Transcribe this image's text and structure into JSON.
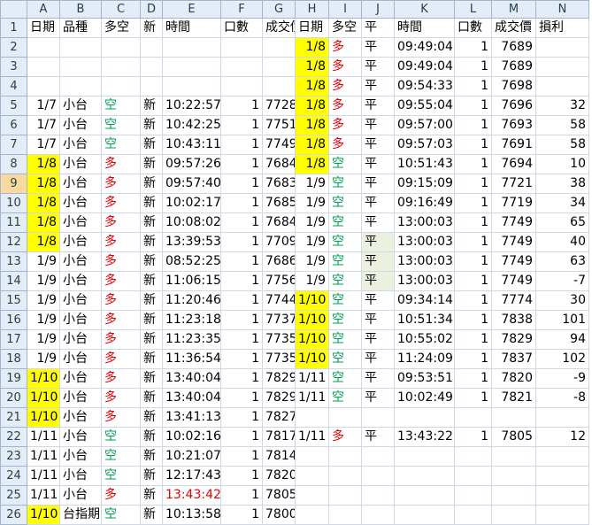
{
  "columns": [
    "A",
    "B",
    "C",
    "D",
    "E",
    "F",
    "G",
    "H",
    "I",
    "J",
    "K",
    "L",
    "M",
    "N"
  ],
  "selected_row": "9",
  "rows": [
    {
      "n": "1",
      "c": [
        "日期",
        "品種",
        "多空",
        "新",
        "時間",
        "口數",
        "成交價",
        "日期",
        "多空",
        "平",
        "時間",
        "口數",
        "成交價",
        "損利"
      ]
    },
    {
      "n": "2",
      "c": [
        "",
        "",
        "",
        "",
        "",
        "",
        "",
        "1/8",
        "多",
        "平",
        "09:49:04",
        "1",
        "7689",
        ""
      ]
    },
    {
      "n": "3",
      "c": [
        "",
        "",
        "",
        "",
        "",
        "",
        "",
        "1/8",
        "多",
        "平",
        "09:49:04",
        "1",
        "7689",
        ""
      ]
    },
    {
      "n": "4",
      "c": [
        "",
        "",
        "",
        "",
        "",
        "",
        "",
        "1/8",
        "多",
        "平",
        "09:54:33",
        "1",
        "7698",
        ""
      ]
    },
    {
      "n": "5",
      "c": [
        "1/7",
        "小台",
        "空",
        "新",
        "10:22:57",
        "1",
        "7728",
        "1/8",
        "多",
        "平",
        "09:55:04",
        "1",
        "7696",
        "32"
      ]
    },
    {
      "n": "6",
      "c": [
        "1/7",
        "小台",
        "空",
        "新",
        "10:42:25",
        "1",
        "7751",
        "1/8",
        "多",
        "平",
        "09:57:00",
        "1",
        "7693",
        "58"
      ]
    },
    {
      "n": "7",
      "c": [
        "1/7",
        "小台",
        "空",
        "新",
        "10:43:11",
        "1",
        "7749",
        "1/8",
        "多",
        "平",
        "09:57:03",
        "1",
        "7691",
        "58"
      ]
    },
    {
      "n": "8",
      "c": [
        "1/8",
        "小台",
        "多",
        "新",
        "09:57:26",
        "1",
        "7684",
        "1/8",
        "空",
        "平",
        "10:51:43",
        "1",
        "7694",
        "10"
      ]
    },
    {
      "n": "9",
      "c": [
        "1/8",
        "小台",
        "多",
        "新",
        "09:57:40",
        "1",
        "7683",
        "1/9",
        "空",
        "平",
        "09:15:09",
        "1",
        "7721",
        "38"
      ]
    },
    {
      "n": "10",
      "c": [
        "1/8",
        "小台",
        "多",
        "新",
        "10:02:17",
        "1",
        "7685",
        "1/9",
        "空",
        "平",
        "09:16:49",
        "1",
        "7719",
        "34"
      ]
    },
    {
      "n": "11",
      "c": [
        "1/8",
        "小台",
        "多",
        "新",
        "10:08:02",
        "1",
        "7684",
        "1/9",
        "空",
        "平",
        "13:00:03",
        "1",
        "7749",
        "65"
      ]
    },
    {
      "n": "12",
      "c": [
        "1/8",
        "小台",
        "多",
        "新",
        "13:39:53",
        "1",
        "7709",
        "1/9",
        "空",
        "平",
        "13:00:03",
        "1",
        "7749",
        "40"
      ]
    },
    {
      "n": "13",
      "c": [
        "1/9",
        "小台",
        "多",
        "新",
        "08:52:25",
        "1",
        "7686",
        "1/9",
        "空",
        "平",
        "13:00:03",
        "1",
        "7749",
        "63"
      ]
    },
    {
      "n": "14",
      "c": [
        "1/9",
        "小台",
        "多",
        "新",
        "11:06:15",
        "1",
        "7756",
        "1/9",
        "空",
        "平",
        "13:00:03",
        "1",
        "7749",
        "-7"
      ]
    },
    {
      "n": "15",
      "c": [
        "1/9",
        "小台",
        "多",
        "新",
        "11:20:46",
        "1",
        "7744",
        "1/10",
        "空",
        "平",
        "09:34:14",
        "1",
        "7774",
        "30"
      ]
    },
    {
      "n": "16",
      "c": [
        "1/9",
        "小台",
        "多",
        "新",
        "11:23:18",
        "1",
        "7737",
        "1/10",
        "空",
        "平",
        "10:51:34",
        "1",
        "7838",
        "101"
      ]
    },
    {
      "n": "17",
      "c": [
        "1/9",
        "小台",
        "多",
        "新",
        "11:23:35",
        "1",
        "7735",
        "1/10",
        "空",
        "平",
        "10:55:02",
        "1",
        "7829",
        "94"
      ]
    },
    {
      "n": "18",
      "c": [
        "1/9",
        "小台",
        "多",
        "新",
        "11:36:54",
        "1",
        "7735",
        "1/10",
        "空",
        "平",
        "11:24:09",
        "1",
        "7837",
        "102"
      ]
    },
    {
      "n": "19",
      "c": [
        "1/10",
        "小台",
        "多",
        "新",
        "13:40:04",
        "1",
        "7829",
        "1/11",
        "空",
        "平",
        "09:53:51",
        "1",
        "7820",
        "-9"
      ]
    },
    {
      "n": "20",
      "c": [
        "1/10",
        "小台",
        "多",
        "新",
        "13:40:04",
        "1",
        "7829",
        "1/11",
        "空",
        "平",
        "10:02:49",
        "1",
        "7821",
        "-8"
      ]
    },
    {
      "n": "21",
      "c": [
        "1/10",
        "小台",
        "多",
        "新",
        "13:41:13",
        "1",
        "7827",
        "",
        "",
        "",
        "",
        "",
        "",
        ""
      ]
    },
    {
      "n": "22",
      "c": [
        "1/11",
        "小台",
        "空",
        "新",
        "10:02:16",
        "1",
        "7817",
        "1/11",
        "多",
        "平",
        "13:43:22",
        "1",
        "7805",
        "12"
      ]
    },
    {
      "n": "23",
      "c": [
        "1/11",
        "小台",
        "空",
        "新",
        "10:21:07",
        "1",
        "7814",
        "",
        "",
        "",
        "",
        "",
        "",
        ""
      ]
    },
    {
      "n": "24",
      "c": [
        "1/11",
        "小台",
        "空",
        "新",
        "12:17:43",
        "1",
        "7820",
        "",
        "",
        "",
        "",
        "",
        "",
        ""
      ]
    },
    {
      "n": "25",
      "c": [
        "1/11",
        "小台",
        "多",
        "新",
        "13:43:42",
        "1",
        "7805",
        "",
        "",
        "",
        "",
        "",
        "",
        ""
      ]
    },
    {
      "n": "26",
      "c": [
        "1/10",
        "台指期",
        "空",
        "新",
        "10:13:58",
        "1",
        "7800",
        "",
        "",
        "",
        "",
        "",
        "",
        ""
      ]
    }
  ]
}
